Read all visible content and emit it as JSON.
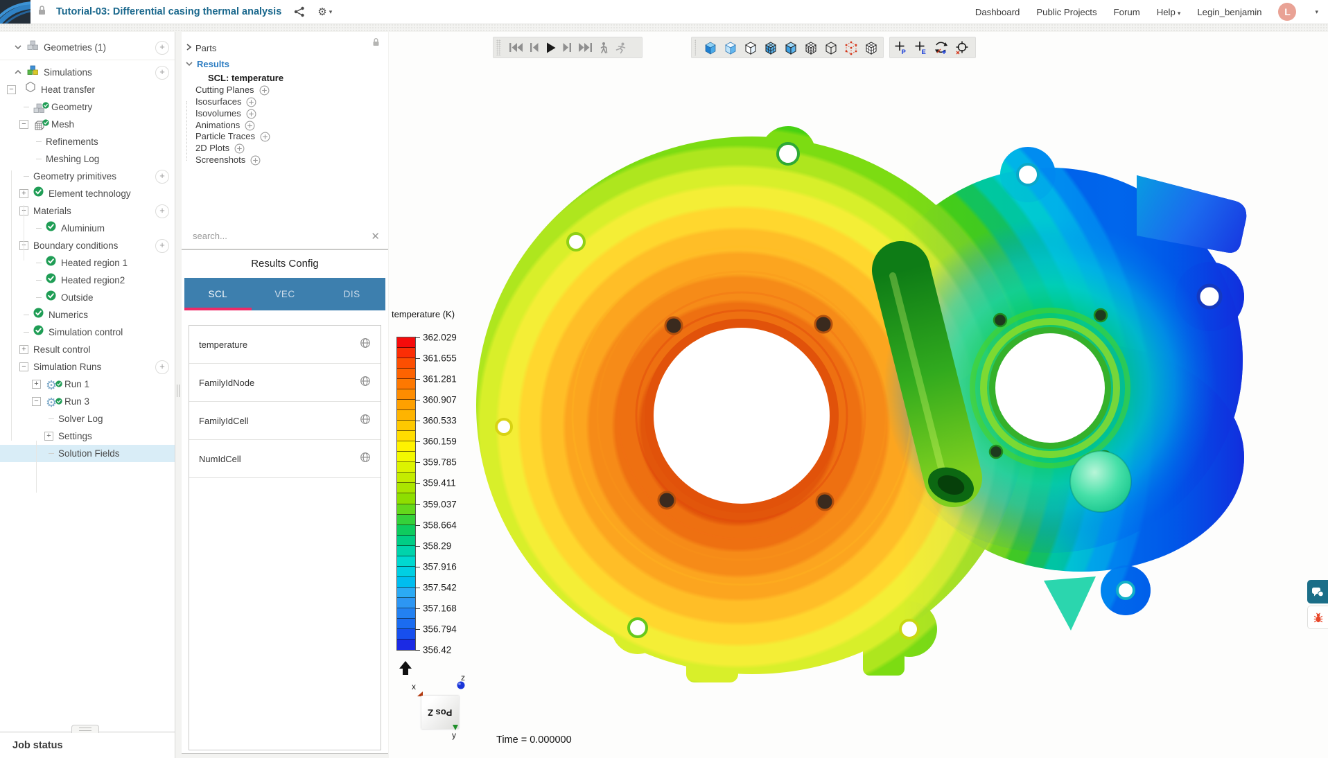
{
  "topbar": {
    "title": "Tutorial-03: Differential casing thermal analysis",
    "privacy": "private",
    "nav": [
      "Dashboard",
      "Public Projects",
      "Forum",
      "Help",
      "Legin_benjamin"
    ],
    "avatar_initial": "L"
  },
  "sidebar": {
    "job_status_label": "Job status",
    "items": [
      {
        "label": "Geometries (1)",
        "depth": 0,
        "icon": "cubes",
        "chev": "down",
        "plus": true,
        "sep": true
      },
      {
        "label": "Simulations",
        "depth": 0,
        "icon": "cubes-color",
        "chev": "up",
        "plus": true
      },
      {
        "label": "Heat transfer",
        "depth": 1,
        "exp": "-",
        "icon": "hexagon"
      },
      {
        "label": "Geometry",
        "depth": 2,
        "icon": "cubes-check",
        "dash": true
      },
      {
        "label": "Mesh",
        "depth": 2,
        "exp": "-",
        "icon": "mesh-check"
      },
      {
        "label": "Refinements",
        "depth": 3,
        "dash": true
      },
      {
        "label": "Meshing Log",
        "depth": 3,
        "dash": true
      },
      {
        "label": "Geometry primitives",
        "depth": 2,
        "dash": true,
        "plus": true
      },
      {
        "label": "Element technology",
        "depth": 2,
        "exp": "+",
        "icon": "check"
      },
      {
        "label": "Materials",
        "depth": 2,
        "exp": "-",
        "plus": true
      },
      {
        "label": "Aluminium",
        "depth": 3,
        "dash": true,
        "icon": "check"
      },
      {
        "label": "Boundary conditions",
        "depth": 2,
        "exp": "-",
        "plus": true
      },
      {
        "label": "Heated region 1",
        "depth": 3,
        "dash": true,
        "icon": "check"
      },
      {
        "label": "Heated region2",
        "depth": 3,
        "dash": true,
        "icon": "check"
      },
      {
        "label": "Outside",
        "depth": 3,
        "dash": true,
        "icon": "check"
      },
      {
        "label": "Numerics",
        "depth": 2,
        "dash": true,
        "icon": "check"
      },
      {
        "label": "Simulation control",
        "depth": 2,
        "dash": true,
        "icon": "check"
      },
      {
        "label": "Result control",
        "depth": 2,
        "exp": "+"
      },
      {
        "label": "Simulation Runs",
        "depth": 2,
        "exp": "-",
        "plus": true
      },
      {
        "label": "Run 1",
        "depth": 3,
        "exp": "+",
        "icon": "gear-check"
      },
      {
        "label": "Run 3",
        "depth": 3,
        "exp": "-",
        "icon": "gear-check"
      },
      {
        "label": "Solver Log",
        "depth": 4,
        "dash": true
      },
      {
        "label": "Settings",
        "depth": 4,
        "exp": "+"
      },
      {
        "label": "Solution Fields",
        "depth": 4,
        "dash": true,
        "active": true
      }
    ]
  },
  "results_panel": {
    "tree": [
      {
        "label": "Parts",
        "kind": "collapsed"
      },
      {
        "label": "Results",
        "kind": "expanded"
      },
      {
        "label": "SCL: temperature",
        "kind": "selected"
      },
      {
        "label": "Cutting Planes",
        "kind": "add"
      },
      {
        "label": "Isosurfaces",
        "kind": "add"
      },
      {
        "label": "Isovolumes",
        "kind": "add"
      },
      {
        "label": "Animations",
        "kind": "add"
      },
      {
        "label": "Particle Traces",
        "kind": "add"
      },
      {
        "label": "2D Plots",
        "kind": "add"
      },
      {
        "label": "Screenshots",
        "kind": "add"
      }
    ],
    "search_placeholder": "search...",
    "config_title": "Results Config",
    "tabs": [
      "SCL",
      "VEC",
      "DIS"
    ],
    "active_tab": "SCL",
    "fields": [
      "temperature",
      "FamilyIdNode",
      "FamilyIdCell",
      "NumIdCell"
    ]
  },
  "viewport": {
    "legend": {
      "title": "temperature (K)",
      "labels": [
        "362.029",
        "361.655",
        "361.281",
        "360.907",
        "360.533",
        "360.159",
        "359.785",
        "359.411",
        "359.037",
        "358.664",
        "358.29",
        "357.916",
        "357.542",
        "357.168",
        "356.794",
        "356.42"
      ],
      "colors": [
        "#f60b0b",
        "#fb2e05",
        "#fc4f02",
        "#fd6301",
        "#fd7801",
        "#fe8c00",
        "#fea000",
        "#feb400",
        "#fec900",
        "#ffdd00",
        "#fff200",
        "#f3f900",
        "#dcf300",
        "#c4ec00",
        "#abe500",
        "#8ede00",
        "#64d81b",
        "#35d13a",
        "#0ecb5e",
        "#00cd85",
        "#00d3ab",
        "#00d8d0",
        "#00cfe3",
        "#00bdef",
        "#2baaf4",
        "#2d96f3",
        "#2381f1",
        "#1b6cf0",
        "#174fee",
        "#1b2ae4"
      ]
    },
    "time_label": "Time = 0.000000",
    "nav_cube_face": "Pos Z",
    "axes": [
      "x",
      "y",
      "z"
    ],
    "toolbars": {
      "playback": [
        "first-frame",
        "previous-frame",
        "play",
        "next-frame",
        "last-frame",
        "walk-mode",
        "run-mode"
      ],
      "view_modes": [
        "surface-shaded",
        "surface-flat",
        "surface-white-edges",
        "surface-mesh",
        "surface-solid-edges",
        "mesh-wireframe-grid",
        "wireframe",
        "point-cloud",
        "hidden-line-mesh"
      ],
      "probe": [
        "pick-point",
        "pick-edge",
        "rotate-view",
        "center-rotation"
      ]
    }
  },
  "accent_colors": {
    "title_teal": "#19678c",
    "tab_bar_blue": "#3d7fae",
    "tab_underline_pink": "#ee2a67",
    "selection_blue": "#d9edf7",
    "check_green": "#1f9d55",
    "chat_teal": "#1b6e88",
    "bug_red": "#e8472a",
    "avatar_salmon": "#e9a295"
  }
}
